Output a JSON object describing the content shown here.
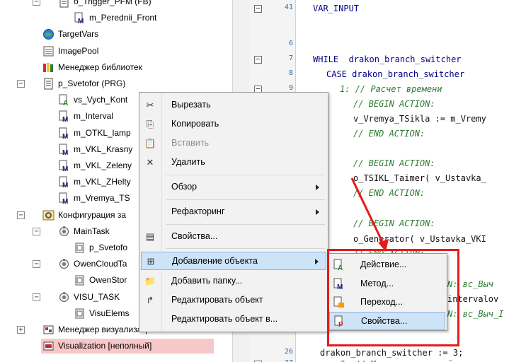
{
  "tree": {
    "items": [
      {
        "label": "o_Trigger_PFM (FB)",
        "indent": 3,
        "expander": "−",
        "icon": "pou-doc-icon"
      },
      {
        "label": "m_Perednii_Front",
        "indent": 4,
        "expander": "",
        "icon": "method-icon"
      },
      {
        "label": "TargetVars",
        "indent": 2,
        "expander": "",
        "icon": "globe-icon"
      },
      {
        "label": "ImagePool",
        "indent": 2,
        "expander": "",
        "icon": "image-pool-icon"
      },
      {
        "label": "Менеджер библиотек",
        "indent": 2,
        "expander": "",
        "icon": "library-icon"
      },
      {
        "label": "p_Svetofor (PRG)",
        "indent": 2,
        "expander": "−",
        "icon": "pou-doc-icon"
      },
      {
        "label": "vs_Vych_Kont",
        "indent": 3,
        "expander": "",
        "icon": "action-icon"
      },
      {
        "label": "m_Interval",
        "indent": 3,
        "expander": "",
        "icon": "method-icon"
      },
      {
        "label": "m_OTKL_lamp",
        "indent": 3,
        "expander": "",
        "icon": "method-icon"
      },
      {
        "label": "m_VKL_Krasny",
        "indent": 3,
        "expander": "",
        "icon": "method-icon"
      },
      {
        "label": "m_VKL_Zeleny",
        "indent": 3,
        "expander": "",
        "icon": "method-icon"
      },
      {
        "label": "m_VKL_ZHelty",
        "indent": 3,
        "expander": "",
        "icon": "method-icon"
      },
      {
        "label": "m_Vremya_TS",
        "indent": 3,
        "expander": "",
        "icon": "method-icon"
      },
      {
        "label": "Конфигурация за",
        "indent": 2,
        "expander": "−",
        "icon": "task-config-icon"
      },
      {
        "label": "MainTask",
        "indent": 3,
        "expander": "−",
        "icon": "task-icon"
      },
      {
        "label": "p_Svetofo",
        "indent": 4,
        "expander": "",
        "icon": "program-call-icon"
      },
      {
        "label": "OwenCloudTa",
        "indent": 3,
        "expander": "−",
        "icon": "task-icon"
      },
      {
        "label": "OwenStor",
        "indent": 4,
        "expander": "",
        "icon": "program-call-icon"
      },
      {
        "label": "VISU_TASK",
        "indent": 3,
        "expander": "−",
        "icon": "task-icon"
      },
      {
        "label": "VisuElems",
        "indent": 4,
        "expander": "",
        "icon": "program-call-icon"
      },
      {
        "label": "Менеджер визуализации",
        "indent": 2,
        "expander": "+",
        "icon": "visu-manager-icon"
      },
      {
        "label": "Visualization [неполный]",
        "indent": 2,
        "expander": "",
        "icon": "visualization-icon",
        "highlight": true
      }
    ]
  },
  "code": {
    "lines": [
      {
        "num": "41",
        "fold": "−",
        "text": "VAR_INPUT",
        "cls": "kw",
        "indent": 1
      },
      {
        "num": "",
        "fold": "",
        "text": "",
        "cls": "tx",
        "indent": 1
      },
      {
        "num": "6",
        "fold": "",
        "text": "",
        "cls": "tx",
        "indent": 1
      },
      {
        "num": "7",
        "fold": "−",
        "text": "WHILE  drakon_branch_switcher",
        "cls": "kw",
        "indent": 1
      },
      {
        "num": "8",
        "fold": "",
        "text": "CASE drakon_branch_switcher",
        "cls": "kw",
        "indent": 2
      },
      {
        "num": "9",
        "fold": "−",
        "text": "1: // Расчет времени",
        "cls": "cm",
        "indent": 3
      },
      {
        "num": "10",
        "fold": "",
        "text": "// BEGIN ACTION:",
        "cls": "cm",
        "indent": 4
      },
      {
        "num": "11",
        "fold": "",
        "text": "v_Vremya_TSikla := m_Vremy",
        "cls": "tx",
        "indent": 4
      },
      {
        "num": "12",
        "fold": "",
        "text": "// END ACTION:",
        "cls": "cm",
        "indent": 4
      },
      {
        "num": "13",
        "fold": "",
        "text": "",
        "cls": "tx",
        "indent": 4
      },
      {
        "num": "14",
        "fold": "",
        "text": "// BEGIN ACTION:",
        "cls": "cm",
        "indent": 4
      },
      {
        "num": "15",
        "fold": "",
        "text": "o_TSIKL_Taimer( v_Ustavka_",
        "cls": "tx",
        "indent": 4
      },
      {
        "num": "16",
        "fold": "",
        "text": "// END ACTION:",
        "cls": "cm",
        "indent": 4
      },
      {
        "num": "17",
        "fold": "",
        "text": "",
        "cls": "tx",
        "indent": 4
      },
      {
        "num": "18",
        "fold": "",
        "text": "// BEGIN ACTION:",
        "cls": "cm",
        "indent": 4
      },
      {
        "num": "19",
        "fold": "",
        "text": "o_Generator( v_Ustavka_VKI",
        "cls": "tx",
        "indent": 4
      },
      {
        "num": "20",
        "fold": "",
        "text": "// END ACTION:",
        "cls": "cm",
        "indent": 4
      },
      {
        "num": "21",
        "fold": "",
        "text": "",
        "cls": "tx",
        "indent": 4
      },
      {
        "num": "22",
        "fold": "−",
        "text": "N: вс_Выч",
        "cls": "cm",
        "indent": 11
      },
      {
        "num": "23",
        "fold": "",
        "text": "intervalov",
        "cls": "tx",
        "indent": 11
      },
      {
        "num": "24",
        "fold": "−",
        "text": "N: вс_Выч_І",
        "cls": "cm",
        "indent": 11
      },
      {
        "num": "25",
        "fold": "",
        "text": "",
        "cls": "tx",
        "indent": 4
      },
      {
        "num": "26",
        "fold": "",
        "text": "drakon_branch_switcher := 3;",
        "cls": "tx",
        "indent": 0
      },
      {
        "num": "27",
        "fold": "−",
        "text": "3: // Машина состояний",
        "cls": "cm",
        "indent": 3
      }
    ]
  },
  "context_menu": {
    "items": [
      {
        "label": "Вырезать",
        "icon": "cut-icon",
        "glyph": "✂",
        "disabled": false,
        "submenu": false,
        "active": false
      },
      {
        "label": "Копировать",
        "icon": "copy-icon",
        "glyph": "⎘",
        "disabled": false,
        "submenu": false,
        "active": false
      },
      {
        "label": "Вставить",
        "icon": "paste-icon",
        "glyph": "📋",
        "disabled": true,
        "submenu": false,
        "active": false
      },
      {
        "label": "Удалить",
        "icon": "delete-icon",
        "glyph": "✕",
        "disabled": false,
        "submenu": false,
        "active": false
      },
      {
        "label": "Обзор",
        "icon": "",
        "glyph": "",
        "disabled": false,
        "submenu": true,
        "active": false,
        "sep_before": true
      },
      {
        "label": "Рефакторинг",
        "icon": "",
        "glyph": "",
        "disabled": false,
        "submenu": true,
        "active": false,
        "sep_before": true
      },
      {
        "label": "Свойства...",
        "icon": "properties-icon",
        "glyph": "▤",
        "disabled": false,
        "submenu": false,
        "active": false,
        "sep_before": true
      },
      {
        "label": "Добавление объекта",
        "icon": "add-object-icon",
        "glyph": "⊞",
        "disabled": false,
        "submenu": true,
        "active": true,
        "sep_before": true
      },
      {
        "label": "Добавить папку...",
        "icon": "folder-icon",
        "glyph": "📁",
        "disabled": false,
        "submenu": false,
        "active": false
      },
      {
        "label": "Редактировать объект",
        "icon": "edit-object-icon",
        "glyph": "↱",
        "disabled": false,
        "submenu": false,
        "active": false
      },
      {
        "label": "Редактировать объект в...",
        "icon": "",
        "glyph": "",
        "disabled": false,
        "submenu": false,
        "active": false
      }
    ]
  },
  "submenu": {
    "items": [
      {
        "label": "Действие...",
        "icon": "action-icon",
        "active": false
      },
      {
        "label": "Метод...",
        "icon": "method-icon",
        "active": false
      },
      {
        "label": "Переход...",
        "icon": "transition-icon",
        "active": false
      },
      {
        "label": "Свойства...",
        "icon": "property-icon",
        "active": true
      }
    ]
  },
  "colors": {
    "annotation_red": "#e41b1b",
    "menu_highlight": "#cde3f7",
    "tree_highlight": "#f8c8c8",
    "keyword": "#00008b",
    "comment": "#2e7d32"
  }
}
